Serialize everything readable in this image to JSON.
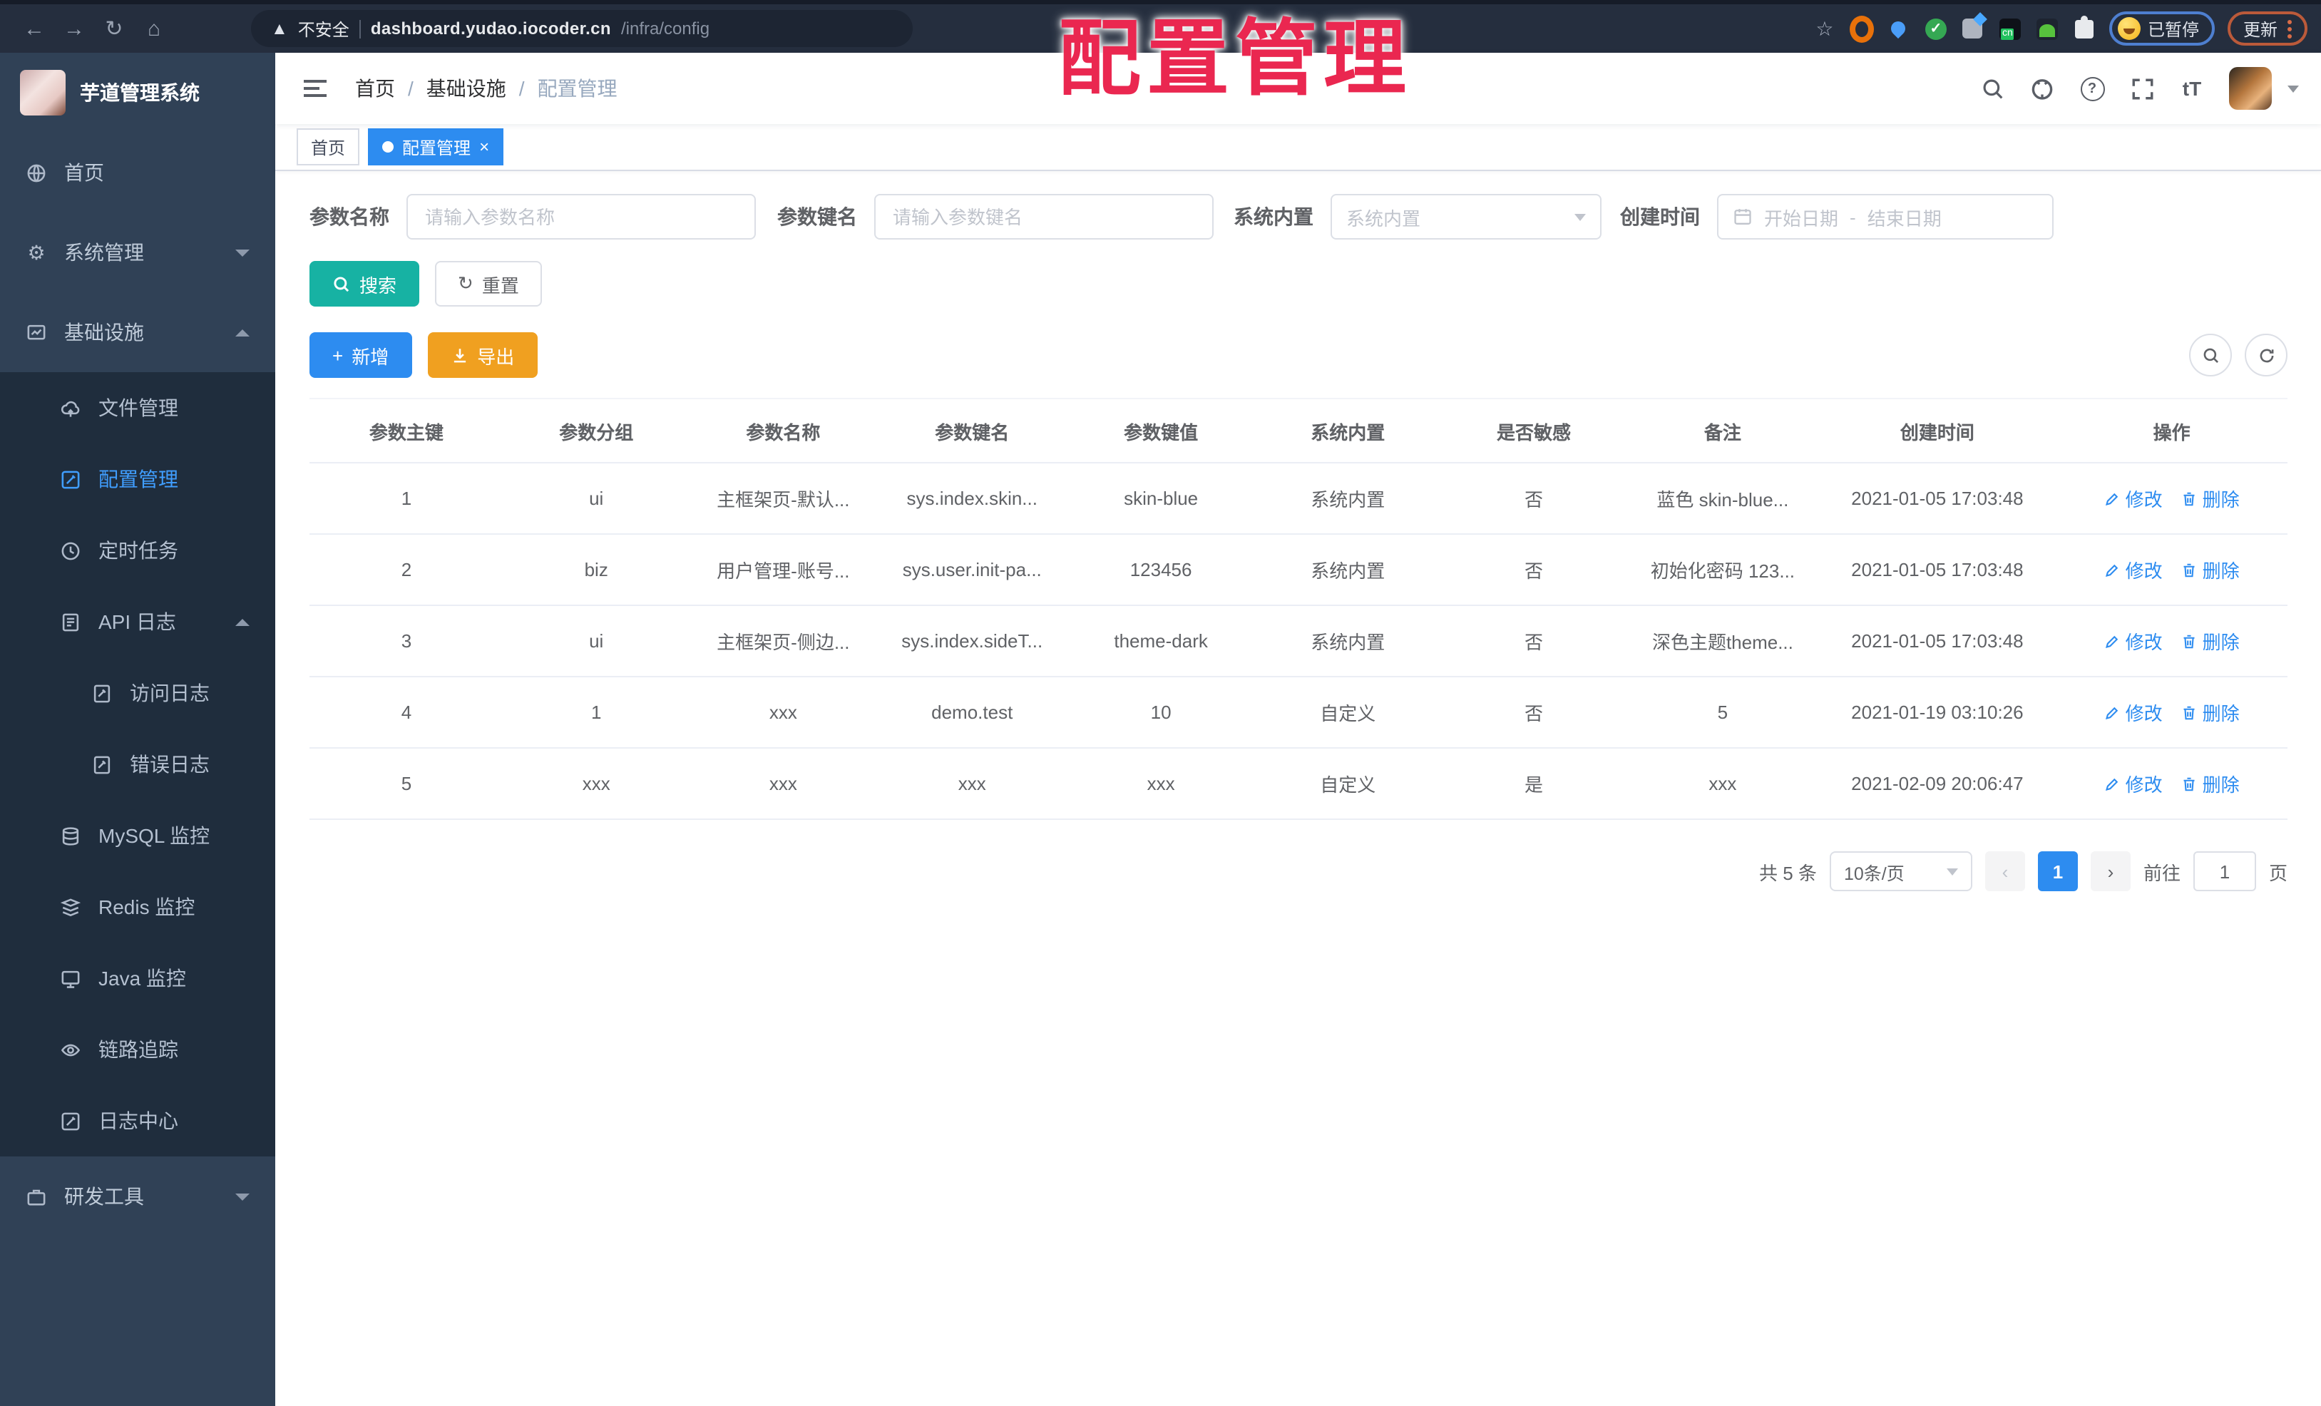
{
  "browser": {
    "security_label": "不安全",
    "url_host": "dashboard.yudao.iocoder.cn",
    "url_path": "/infra/config",
    "paused_badge": "已暂停",
    "update_button": "更新"
  },
  "watermark": "配置管理",
  "sidebar": {
    "app_title": "芋道管理系统",
    "items": [
      {
        "label": "首页"
      },
      {
        "label": "系统管理"
      },
      {
        "label": "基础设施"
      },
      {
        "label": "文件管理"
      },
      {
        "label": "配置管理"
      },
      {
        "label": "定时任务"
      },
      {
        "label": "API 日志"
      },
      {
        "label": "访问日志"
      },
      {
        "label": "错误日志"
      },
      {
        "label": "MySQL 监控"
      },
      {
        "label": "Redis 监控"
      },
      {
        "label": "Java 监控"
      },
      {
        "label": "链路追踪"
      },
      {
        "label": "日志中心"
      },
      {
        "label": "研发工具"
      }
    ]
  },
  "header": {
    "breadcrumb": [
      "首页",
      "基础设施",
      "配置管理"
    ]
  },
  "tags": {
    "inactive": "首页",
    "active": "配置管理"
  },
  "filters": {
    "name_label": "参数名称",
    "name_placeholder": "请输入参数名称",
    "key_label": "参数键名",
    "key_placeholder": "请输入参数键名",
    "type_label": "系统内置",
    "type_placeholder": "系统内置",
    "date_label": "创建时间",
    "date_start": "开始日期",
    "date_separator": "-",
    "date_end": "结束日期",
    "search": "搜索",
    "reset": "重置"
  },
  "toolbar": {
    "add": "新增",
    "export": "导出"
  },
  "table": {
    "headers": [
      "参数主键",
      "参数分组",
      "参数名称",
      "参数键名",
      "参数键值",
      "系统内置",
      "是否敏感",
      "备注",
      "创建时间",
      "操作"
    ],
    "action_edit": "修改",
    "action_delete": "删除",
    "rows": [
      [
        "1",
        "ui",
        "主框架页-默认...",
        "sys.index.skin...",
        "skin-blue",
        "系统内置",
        "否",
        "蓝色 skin-blue...",
        "2021-01-05 17:03:48"
      ],
      [
        "2",
        "biz",
        "用户管理-账号...",
        "sys.user.init-pa...",
        "123456",
        "系统内置",
        "否",
        "初始化密码 123...",
        "2021-01-05 17:03:48"
      ],
      [
        "3",
        "ui",
        "主框架页-侧边...",
        "sys.index.sideT...",
        "theme-dark",
        "系统内置",
        "否",
        "深色主题theme...",
        "2021-01-05 17:03:48"
      ],
      [
        "4",
        "1",
        "xxx",
        "demo.test",
        "10",
        "自定义",
        "否",
        "5",
        "2021-01-19 03:10:26"
      ],
      [
        "5",
        "xxx",
        "xxx",
        "xxx",
        "xxx",
        "自定义",
        "是",
        "xxx",
        "2021-02-09 20:06:47"
      ]
    ]
  },
  "pagination": {
    "total": "共 5 条",
    "page_size": "10条/页",
    "current": "1",
    "goto_label": "前往",
    "goto_value": "1",
    "goto_suffix": "页"
  },
  "colors": {
    "accent": "#2d8cf0",
    "sidebar_bg": "#304156",
    "submenu_bg": "#1f2d3d",
    "search_button": "#17b2a3",
    "export_button": "#f0a020",
    "watermark_red": "#ea2750"
  }
}
